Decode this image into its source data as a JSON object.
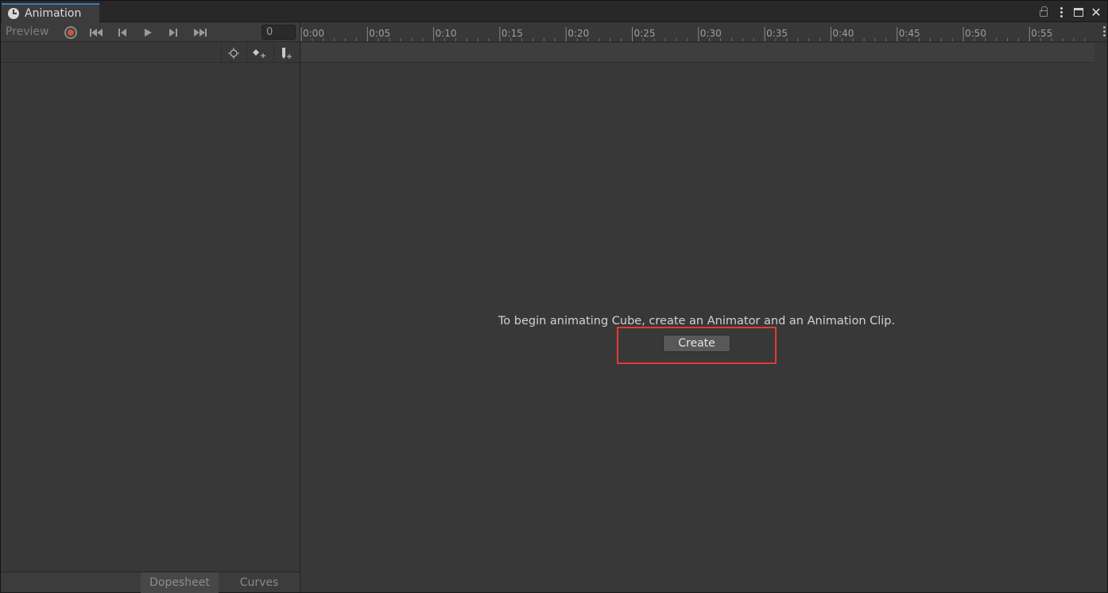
{
  "window": {
    "tab_title": "Animation",
    "tab_icon": "clock-icon"
  },
  "toolbar": {
    "preview_label": "Preview",
    "frame_value": "0"
  },
  "timeline": {
    "tick_labels": [
      "0:00",
      "0:05",
      "0:10",
      "0:15",
      "0:20",
      "0:25",
      "0:30",
      "0:35",
      "0:40",
      "0:45",
      "0:50",
      "0:55"
    ]
  },
  "main": {
    "message": "To begin animating Cube, create an Animator and an Animation Clip.",
    "create_label": "Create"
  },
  "bottom_tabs": {
    "dopesheet": "Dopesheet",
    "curves": "Curves"
  },
  "colors": {
    "accent_tab": "#3a79bb",
    "record": "#c9593b",
    "highlight": "#e53935"
  }
}
